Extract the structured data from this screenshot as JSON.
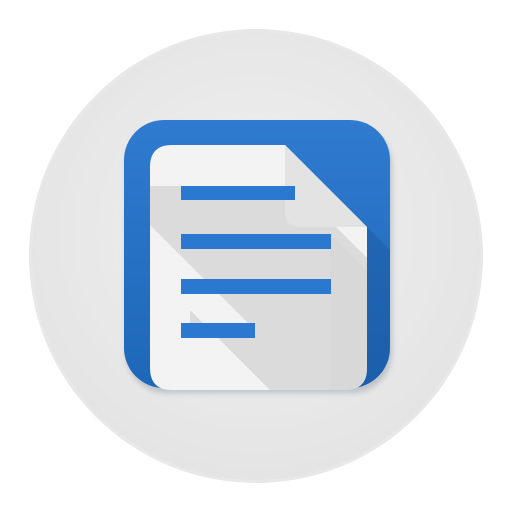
{
  "icon": {
    "name": "writer-document-icon",
    "colors": {
      "outer_circle": "#eeeeee",
      "outer_circle_edge": "#d9d9d9",
      "tile_blue": "#1e67b8",
      "tile_blue_top": "#2f7bd0",
      "tile_shadow": "#174f8e",
      "paper": "#f3f3f3",
      "paper_shade": "#d6d6d6",
      "fold": "#e3e3e3",
      "text_lines": "#2a78cf"
    }
  }
}
